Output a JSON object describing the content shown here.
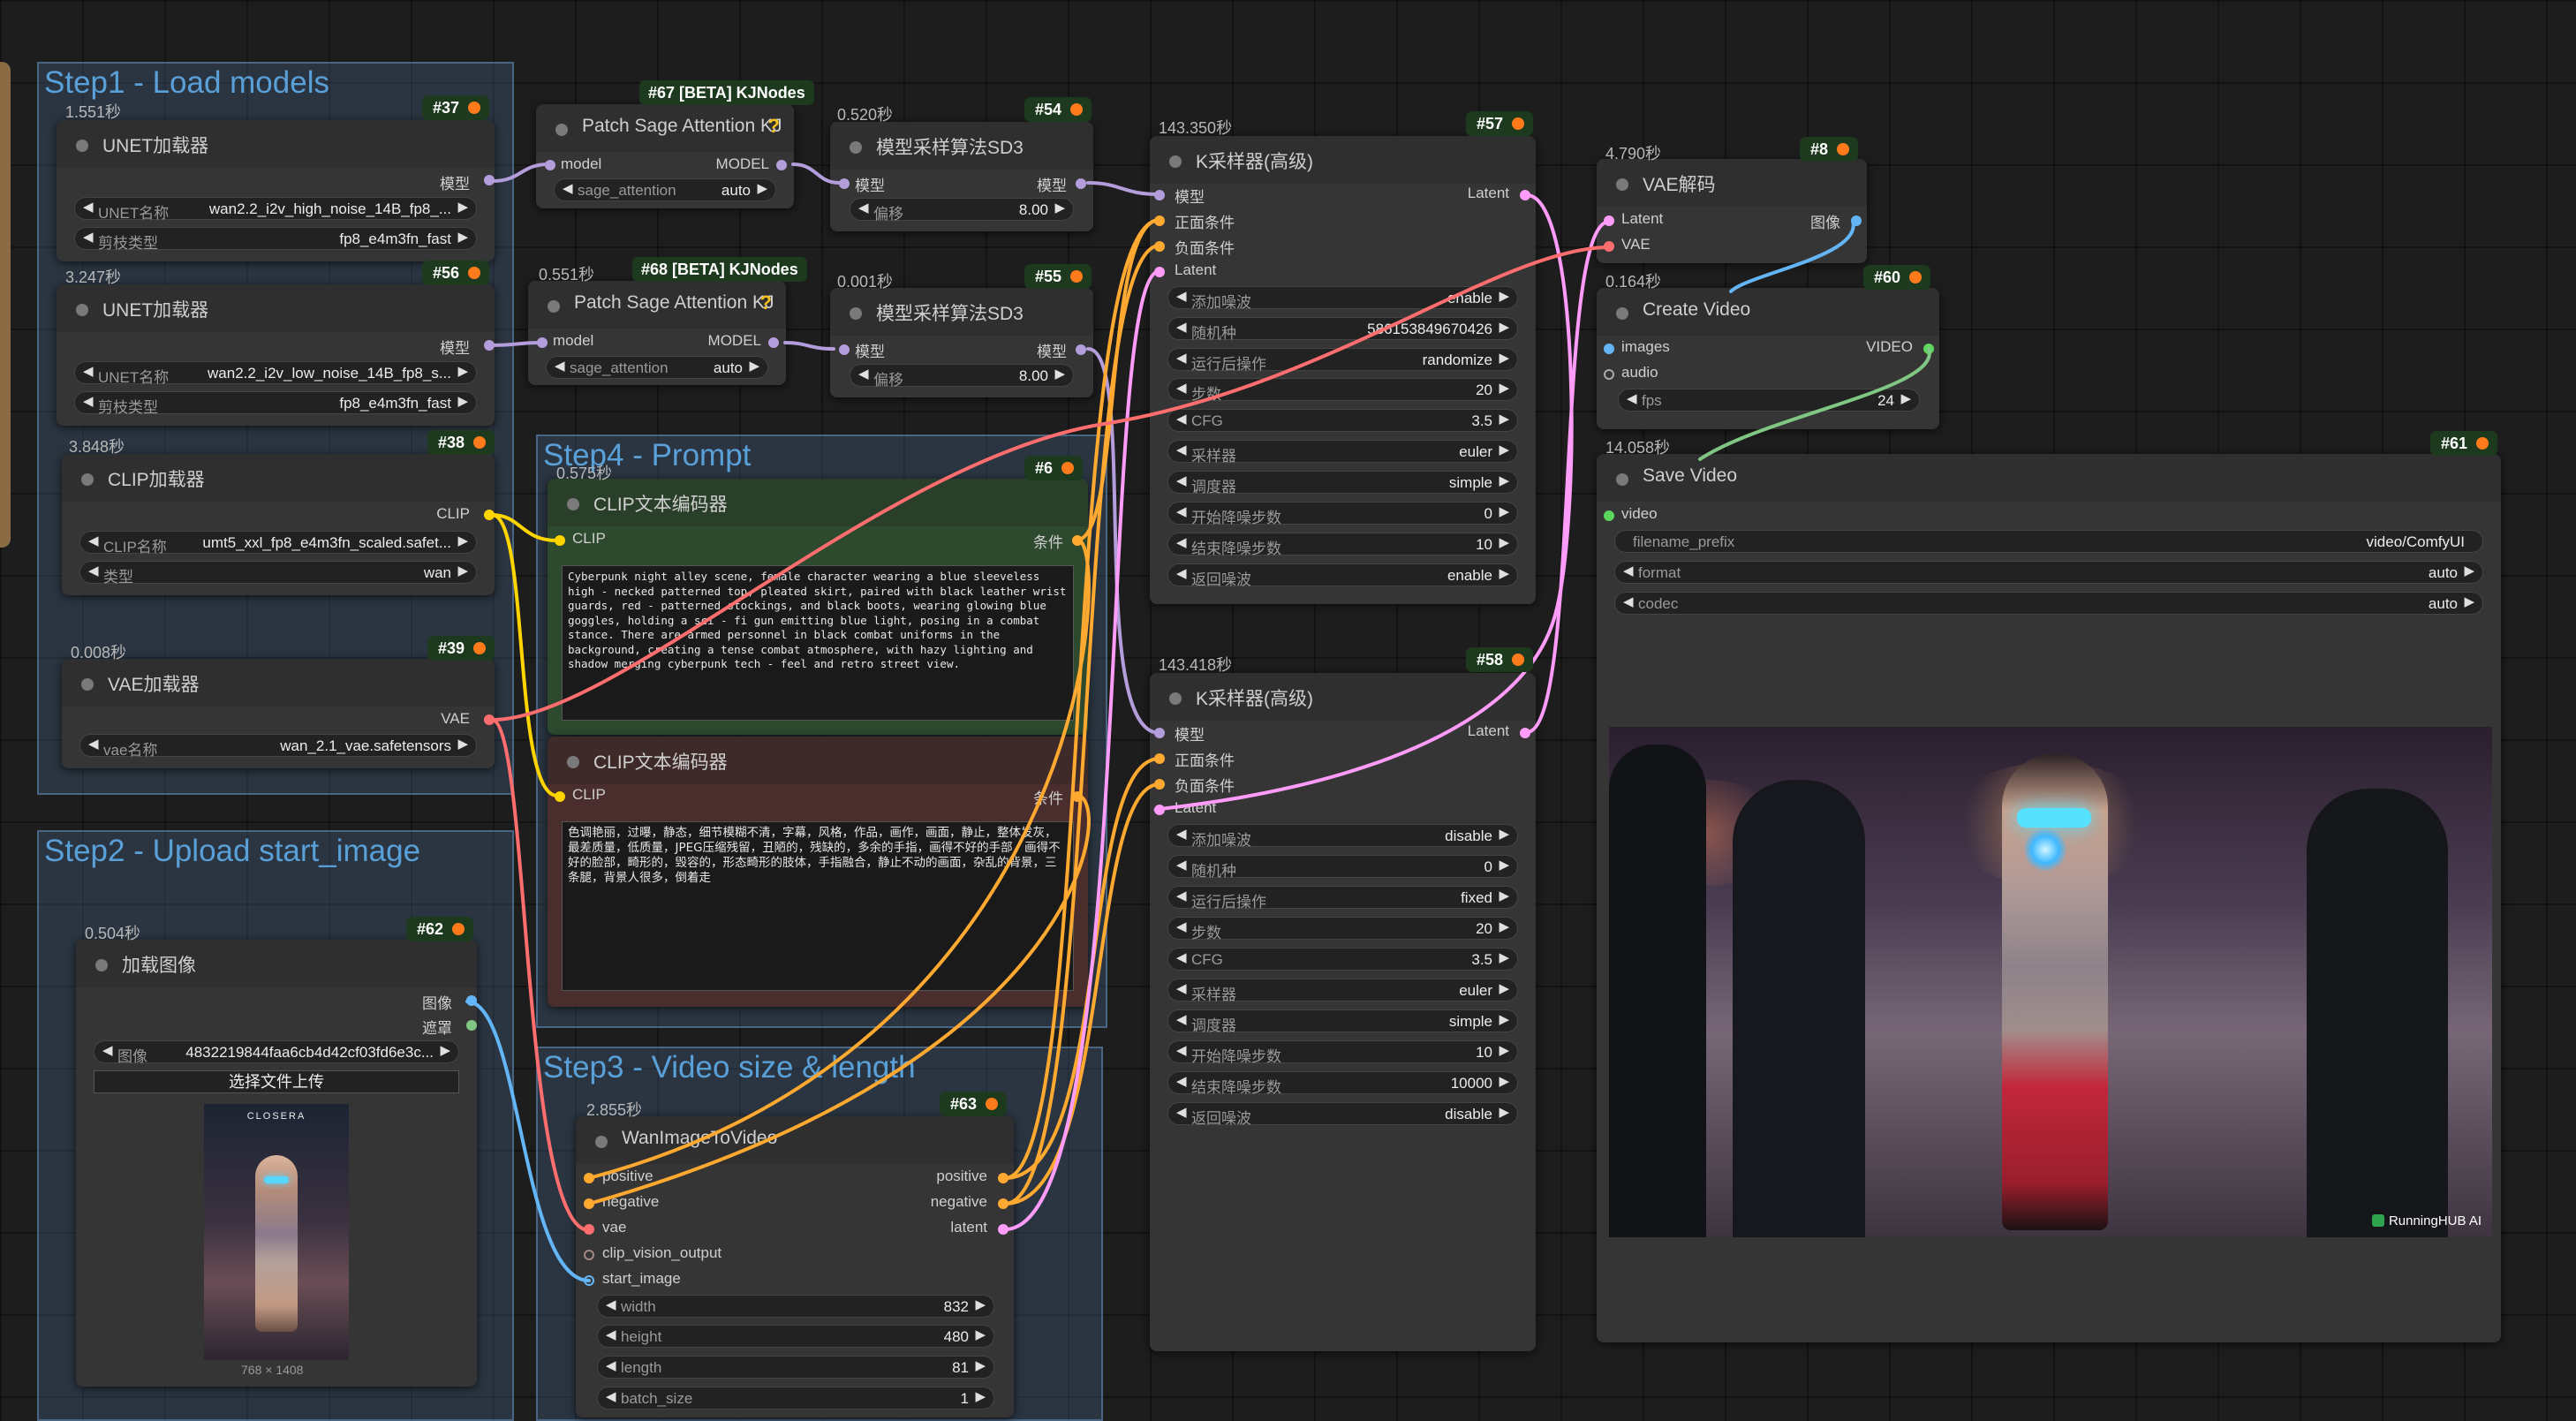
{
  "groups": {
    "step1": "Step1 - Load models",
    "step2": "Step2 - Upload start_image",
    "step4": "Step4 -  Prompt",
    "step3": "Step3 - Video size & length"
  },
  "nodes": {
    "unet_high": {
      "time": "1.551秒",
      "id": "#37",
      "title": "UNET加载器",
      "out_model": "模型",
      "w1_label": "UNET名称",
      "w1_value": "wan2.2_i2v_high_noise_14B_fp8_...",
      "w2_label": "剪枝类型",
      "w2_value": "fp8_e4m3fn_fast"
    },
    "unet_low": {
      "time": "3.247秒",
      "id": "#56",
      "title": "UNET加载器",
      "out_model": "模型",
      "w1_label": "UNET名称",
      "w1_value": "wan2.2_i2v_low_noise_14B_fp8_s...",
      "w2_label": "剪枝类型",
      "w2_value": "fp8_e4m3fn_fast"
    },
    "clip_loader": {
      "time": "3.848秒",
      "id": "#38",
      "title": "CLIP加载器",
      "out_clip": "CLIP",
      "w1_label": "CLIP名称",
      "w1_value": "umt5_xxl_fp8_e4m3fn_scaled.safet...",
      "w2_label": "类型",
      "w2_value": "wan"
    },
    "vae_loader": {
      "time": "0.008秒",
      "id": "#39",
      "title": "VAE加载器",
      "out_vae": "VAE",
      "w1_label": "vae名称",
      "w1_value": "wan_2.1_vae.safetensors"
    },
    "load_image": {
      "time": "0.504秒",
      "id": "#62",
      "title": "加载图像",
      "out_image": "图像",
      "out_mask": "遮罩",
      "w1_label": "图像",
      "w1_value": "4832219844faa6cb4d42cf03fd6e3c...",
      "upload_label": "选择文件上传",
      "thumb_logo": "CLOSERA",
      "size_label": "768 × 1408"
    },
    "patch_sage_1": {
      "badge": "#67 [BETA] KJNodes",
      "title": "Patch Sage Attention KJ",
      "help": "?",
      "in_model": "model",
      "out_model": "MODEL",
      "w1_label": "sage_attention",
      "w1_value": "auto"
    },
    "patch_sage_2": {
      "time": "0.551秒",
      "badge": "#68 [BETA] KJNodes",
      "title": "Patch Sage Attention KJ",
      "help": "?",
      "in_model": "model",
      "out_model": "MODEL",
      "w1_label": "sage_attention",
      "w1_value": "auto"
    },
    "sd3_1": {
      "time": "0.520秒",
      "id": "#54",
      "title": "模型采样算法SD3",
      "in_model": "模型",
      "out_model": "模型",
      "w1_label": "偏移",
      "w1_value": "8.00"
    },
    "sd3_2": {
      "time": "0.001秒",
      "id": "#55",
      "title": "模型采样算法SD3",
      "in_model": "模型",
      "out_model": "模型",
      "w1_label": "偏移",
      "w1_value": "8.00"
    },
    "clip_pos": {
      "time": "0.575秒",
      "id": "#6",
      "title": "CLIP文本编码器",
      "in_clip": "CLIP",
      "out_cond": "条件",
      "text": "Cyberpunk night alley scene, female character wearing a blue sleeveless high - necked patterned top, pleated skirt, paired with black leather wrist guards, red - patterned stockings, and black boots, wearing glowing blue goggles, holding a sci - fi gun emitting blue light, posing in a combat stance. There are armed personnel in black combat uniforms in the background, creating a tense combat atmosphere, with hazy lighting and shadow merging cyberpunk tech - feel and retro street view."
    },
    "clip_neg": {
      "title": "CLIP文本编码器",
      "in_clip": "CLIP",
      "out_cond": "条件",
      "text": "色调艳丽，过曝，静态，细节模糊不清，字幕，风格，作品，画作，画面，静止，整体发灰，最差质量，低质量，JPEG压缩残留，丑陋的，残缺的，多余的手指，画得不好的手部，画得不好的脸部，畸形的，毁容的，形态畸形的肢体，手指融合，静止不动的画面，杂乱的背景，三条腿，背景人很多，倒着走"
    },
    "wan_i2v": {
      "time": "2.855秒",
      "id": "#63",
      "title": "WanImageToVideo",
      "in_positive": "positive",
      "in_negative": "negative",
      "in_vae": "vae",
      "in_clip_vision": "clip_vision_output",
      "in_start_image": "start_image",
      "out_positive": "positive",
      "out_negative": "negative",
      "out_latent": "latent",
      "widgets": [
        {
          "label": "width",
          "value": "832"
        },
        {
          "label": "height",
          "value": "480"
        },
        {
          "label": "length",
          "value": "81"
        },
        {
          "label": "batch_size",
          "value": "1"
        }
      ]
    },
    "ksampler_1": {
      "time": "143.350秒",
      "id": "#57",
      "title": "K采样器(高级)",
      "in_model": "模型",
      "in_pos": "正面条件",
      "in_neg": "负面条件",
      "in_latent": "Latent",
      "out_latent": "Latent",
      "widgets": [
        {
          "label": "添加噪波",
          "value": "enable"
        },
        {
          "label": "随机种",
          "value": "586153849670426"
        },
        {
          "label": "运行后操作",
          "value": "randomize"
        },
        {
          "label": "步数",
          "value": "20"
        },
        {
          "label": "CFG",
          "value": "3.5"
        },
        {
          "label": "采样器",
          "value": "euler"
        },
        {
          "label": "调度器",
          "value": "simple"
        },
        {
          "label": "开始降噪步数",
          "value": "0"
        },
        {
          "label": "结束降噪步数",
          "value": "10"
        },
        {
          "label": "返回噪波",
          "value": "enable"
        }
      ]
    },
    "ksampler_2": {
      "time": "143.418秒",
      "id": "#58",
      "title": "K采样器(高级)",
      "in_model": "模型",
      "in_pos": "正面条件",
      "in_neg": "负面条件",
      "in_latent": "Latent",
      "out_latent": "Latent",
      "widgets": [
        {
          "label": "添加噪波",
          "value": "disable"
        },
        {
          "label": "随机种",
          "value": "0"
        },
        {
          "label": "运行后操作",
          "value": "fixed"
        },
        {
          "label": "步数",
          "value": "20"
        },
        {
          "label": "CFG",
          "value": "3.5"
        },
        {
          "label": "采样器",
          "value": "euler"
        },
        {
          "label": "调度器",
          "value": "simple"
        },
        {
          "label": "开始降噪步数",
          "value": "10"
        },
        {
          "label": "结束降噪步数",
          "value": "10000"
        },
        {
          "label": "返回噪波",
          "value": "disable"
        }
      ]
    },
    "vae_decode": {
      "time": "4.790秒",
      "id": "#8",
      "title": "VAE解码",
      "in_latent": "Latent",
      "in_vae": "VAE",
      "out_image": "图像"
    },
    "create_video": {
      "time": "0.164秒",
      "id": "#60",
      "title": "Create Video",
      "in_images": "images",
      "in_audio": "audio",
      "out_video": "VIDEO",
      "w1_label": "fps",
      "w1_value": "24"
    },
    "save_video": {
      "time": "14.058秒",
      "id": "#61",
      "title": "Save Video",
      "in_video": "video",
      "widgets": [
        {
          "label": "filename_prefix",
          "value": "video/ComfyUI"
        },
        {
          "label": "format",
          "value": "auto"
        },
        {
          "label": "codec",
          "value": "auto"
        }
      ],
      "watermark": "RunningHUB AI"
    }
  },
  "colors": {
    "model": "#b39ddb",
    "clip": "#ffd500",
    "vae": "#ff6e6e",
    "cond": "#ffa931",
    "latent": "#ff9cf9",
    "image": "#64b5f6",
    "mask": "#81c784",
    "video": "#5cd65c",
    "clip_vision": "#a1887f",
    "accent_group": "#5aa0d8"
  },
  "icons": [
    "fox-icon",
    "help-icon",
    "arrow-left-icon",
    "arrow-right-icon"
  ]
}
